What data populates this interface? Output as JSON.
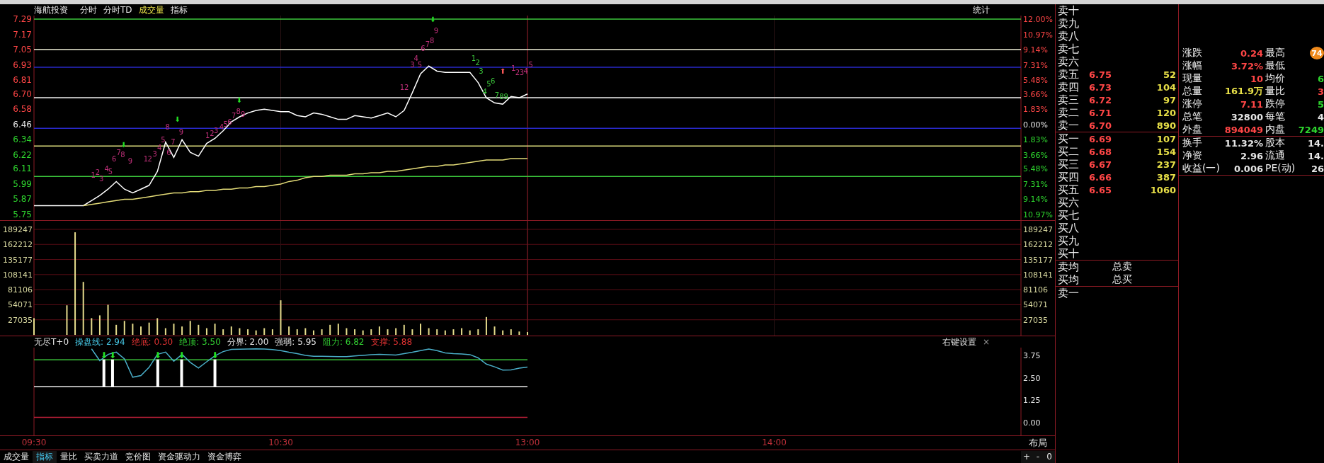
{
  "header": {
    "title": "海航投资",
    "tabs": [
      {
        "label": "分时",
        "selected": false
      },
      {
        "label": "分时TD",
        "selected": false
      },
      {
        "label": "成交量",
        "selected": true
      },
      {
        "label": "指标",
        "selected": false
      }
    ],
    "stats_label": "统计"
  },
  "price_chart": {
    "pct_axis": [
      {
        "label": "12.00%",
        "kind": "up"
      },
      {
        "label": "10.97%",
        "kind": "up"
      },
      {
        "label": "9.14%",
        "kind": "up"
      },
      {
        "label": "7.31%",
        "kind": "up"
      },
      {
        "label": "5.48%",
        "kind": "up"
      },
      {
        "label": "3.66%",
        "kind": "up"
      },
      {
        "label": "1.83%",
        "kind": "up"
      },
      {
        "label": "0.00%",
        "kind": "flat"
      },
      {
        "label": "1.83%",
        "kind": "down"
      },
      {
        "label": "3.66%",
        "kind": "down"
      },
      {
        "label": "5.48%",
        "kind": "down"
      },
      {
        "label": "7.31%",
        "kind": "down"
      },
      {
        "label": "9.14%",
        "kind": "down"
      },
      {
        "label": "10.97%",
        "kind": "down"
      }
    ],
    "chart_data": {
      "type": "line",
      "ylim": [
        5.75,
        7.29
      ],
      "yticks": [
        {
          "value": 7.29,
          "label": "7.29"
        },
        {
          "value": 7.17,
          "label": "7.17"
        },
        {
          "value": 7.05,
          "label": "7.05"
        },
        {
          "value": 6.93,
          "label": "6.93"
        },
        {
          "value": 6.81,
          "label": "6.81"
        },
        {
          "value": 6.7,
          "label": "6.70"
        },
        {
          "value": 6.58,
          "label": "6.58"
        },
        {
          "value": 6.46,
          "label": "6.46"
        },
        {
          "value": 6.34,
          "label": "6.34"
        },
        {
          "value": 6.22,
          "label": "6.22"
        },
        {
          "value": 6.11,
          "label": "6.11"
        },
        {
          "value": 5.99,
          "label": "5.99"
        },
        {
          "value": 5.87,
          "label": "5.87"
        },
        {
          "value": 5.75,
          "label": "5.75"
        }
      ],
      "categories": [
        null,
        null,
        null,
        null,
        null,
        null,
        null,
        null,
        null,
        null,
        null,
        null,
        null,
        null,
        null,
        null,
        null,
        null,
        null,
        null,
        null,
        null,
        null,
        null,
        null,
        null,
        null,
        null,
        null,
        null,
        null,
        null,
        null,
        null,
        null,
        null,
        null,
        null,
        null,
        null,
        null,
        null,
        null,
        null,
        null,
        null,
        null,
        null,
        null,
        null,
        null,
        null,
        null,
        null,
        null,
        null,
        null,
        null,
        null,
        null,
        null,
        null,
        null,
        null,
        null,
        null,
        null,
        null,
        null,
        null,
        null,
        null,
        null,
        null,
        null,
        null,
        null,
        null,
        null,
        null,
        null,
        null,
        null,
        null,
        null,
        null,
        null,
        null,
        null,
        null,
        null,
        null,
        null,
        null,
        null,
        null,
        null,
        null,
        null,
        null,
        null,
        null,
        null,
        null,
        null,
        null,
        null,
        null,
        null,
        null,
        null,
        null,
        null,
        null,
        null,
        null,
        null,
        null,
        null,
        null,
        null
      ],
      "series": [
        {
          "color": "#ffffff",
          "values": [
            5.82,
            5.82,
            5.82,
            5.82,
            5.82,
            5.82,
            5.82,
            5.86,
            5.9,
            5.95,
            6.01,
            5.95,
            5.92,
            5.95,
            5.98,
            6.09,
            6.32,
            6.2,
            6.34,
            6.24,
            6.21,
            6.31,
            6.35,
            6.41,
            6.48,
            6.52,
            6.55,
            6.57,
            6.58,
            6.57,
            6.56,
            6.56,
            6.53,
            6.52,
            6.55,
            6.54,
            6.52,
            6.5,
            6.5,
            6.53,
            6.52,
            6.51,
            6.53,
            6.55,
            6.52,
            6.57,
            6.71,
            6.86,
            6.92,
            6.88,
            6.87,
            6.87,
            6.87,
            6.87,
            6.79,
            6.67,
            6.63,
            6.62,
            6.68,
            6.67,
            6.7,
            null,
            null,
            null,
            null,
            null,
            null,
            null,
            null,
            null,
            null,
            null,
            null,
            null,
            null,
            null,
            null,
            null,
            null,
            null,
            null,
            null,
            null,
            null,
            null,
            null,
            null,
            null,
            null,
            null,
            null,
            null,
            null,
            null,
            null,
            null,
            null,
            null,
            null,
            null,
            null,
            null,
            null,
            null,
            null,
            null,
            null,
            null,
            null,
            null,
            null,
            null,
            null,
            null,
            null,
            null,
            null,
            null,
            null,
            null,
            null
          ]
        },
        {
          "color": "#e4dc78",
          "values": [
            null,
            null,
            null,
            null,
            null,
            null,
            5.82,
            5.83,
            5.84,
            5.85,
            5.86,
            5.87,
            5.87,
            5.88,
            5.89,
            5.9,
            5.91,
            5.92,
            5.92,
            5.93,
            5.93,
            5.94,
            5.94,
            5.95,
            5.95,
            5.96,
            5.96,
            5.97,
            5.97,
            5.98,
            5.99,
            6.01,
            6.02,
            6.04,
            6.05,
            6.05,
            6.06,
            6.06,
            6.06,
            6.07,
            6.07,
            6.08,
            6.08,
            6.09,
            6.09,
            6.1,
            6.11,
            6.12,
            6.13,
            6.13,
            6.14,
            6.14,
            6.15,
            6.16,
            6.17,
            6.18,
            6.18,
            6.18,
            6.19,
            6.19,
            6.19,
            null,
            null,
            null,
            null,
            null,
            null,
            null,
            null,
            null,
            null,
            null,
            null,
            null,
            null,
            null,
            null,
            null,
            null,
            null,
            null,
            null,
            null,
            null,
            null,
            null,
            null,
            null,
            null,
            null,
            null,
            null,
            null,
            null,
            null,
            null,
            null,
            null,
            null,
            null,
            null,
            null,
            null,
            null,
            null,
            null,
            null,
            null,
            null,
            null,
            null,
            null,
            null,
            null,
            null,
            null,
            null,
            null,
            null,
            null,
            null
          ]
        }
      ],
      "ref_lines": [
        {
          "axis": "y",
          "value": 7.29,
          "color": "#3cc83c"
        },
        {
          "axis": "y",
          "value": 7.05,
          "color": "#f0f0d8"
        },
        {
          "axis": "y",
          "value": 6.91,
          "color": "#2828c8"
        },
        {
          "axis": "y",
          "value": 6.67,
          "color": "#f0f0f0"
        },
        {
          "axis": "y",
          "value": 6.43,
          "color": "#2828c8"
        },
        {
          "axis": "y",
          "value": 6.29,
          "color": "#e0e080"
        },
        {
          "axis": "y",
          "value": 6.05,
          "color": "#3cc83c"
        }
      ],
      "annotations": [
        "1",
        "2",
        "3",
        "4",
        "5",
        "6",
        "7",
        "8",
        "9",
        "⬇",
        "1",
        "2",
        "3",
        "4",
        "5",
        "6",
        "7",
        "8",
        "9",
        "⬇",
        "1",
        "2",
        "3",
        "4",
        "5",
        "6",
        "7",
        "8",
        "9",
        "⬇",
        "1",
        "2",
        "3",
        "4",
        "5",
        "6",
        "7",
        "8",
        "9",
        "⬇",
        "1",
        "2",
        "3",
        "4",
        "5",
        "6",
        "7",
        "8",
        "9",
        "⬆",
        "1",
        "2",
        "3",
        "4",
        "5"
      ]
    },
    "annotation_styles": [
      {
        "color": "#c0307a"
      },
      {
        "color": "#c0307a"
      },
      {
        "color": "#c0307a"
      },
      {
        "color": "#c0307a"
      },
      {
        "color": "#c0307a"
      },
      {
        "color": "#c0307a"
      },
      {
        "color": "#c0307a"
      },
      {
        "color": "#c0307a"
      },
      {
        "color": "#c0307a"
      },
      {
        "color": "#22e022"
      },
      {
        "color": "#c0307a"
      },
      {
        "color": "#c0307a"
      },
      {
        "color": "#c0307a"
      },
      {
        "color": "#c0307a"
      },
      {
        "color": "#c0307a"
      },
      {
        "color": "#c0307a"
      },
      {
        "color": "#c0307a"
      },
      {
        "color": "#c0307a"
      },
      {
        "color": "#c0307a"
      },
      {
        "color": "#22e022"
      },
      {
        "color": "#c0307a"
      },
      {
        "color": "#c0307a"
      },
      {
        "color": "#c0307a"
      },
      {
        "color": "#c0307a"
      },
      {
        "color": "#c0307a"
      },
      {
        "color": "#c0307a"
      },
      {
        "color": "#c0307a"
      },
      {
        "color": "#c0307a"
      },
      {
        "color": "#c0307a"
      },
      {
        "color": "#22e022"
      },
      {
        "color": "#c0307a"
      },
      {
        "color": "#c0307a"
      },
      {
        "color": "#c0307a"
      },
      {
        "color": "#c0307a"
      },
      {
        "color": "#c0307a"
      },
      {
        "color": "#c0307a"
      },
      {
        "color": "#c0307a"
      },
      {
        "color": "#c0307a"
      },
      {
        "color": "#c0307a"
      },
      {
        "color": "#22e022"
      },
      {
        "color": "#3cc83c"
      },
      {
        "color": "#3cc83c"
      },
      {
        "color": "#3cc83c"
      },
      {
        "color": "#3cc83c"
      },
      {
        "color": "#3cc83c"
      },
      {
        "color": "#3cc83c"
      },
      {
        "color": "#3cc83c"
      },
      {
        "color": "#3cc83c"
      },
      {
        "color": "#3cc83c"
      },
      {
        "color": "#ff5a5a"
      },
      {
        "color": "#c0307a"
      },
      {
        "color": "#c0307a"
      },
      {
        "color": "#c0307a"
      },
      {
        "color": "#c0307a"
      },
      {
        "color": "#c0307a"
      }
    ]
  },
  "volume": {
    "right_axis": [
      "189247",
      "162212",
      "135177",
      "108141",
      "81106",
      "54071",
      "27035"
    ],
    "chart_data": {
      "type": "bar",
      "grid": true,
      "ylim": [
        0,
        204455
      ],
      "yticks": [
        {
          "value": 189247,
          "label": "189247"
        },
        {
          "value": 162212,
          "label": "162212"
        },
        {
          "value": 135177,
          "label": "135177"
        },
        {
          "value": 108141,
          "label": "108141"
        },
        {
          "value": 81106,
          "label": "81106"
        },
        {
          "value": 54071,
          "label": "54071"
        },
        {
          "value": 27035,
          "label": "27035"
        }
      ],
      "categories": [
        null,
        null,
        null,
        null,
        null,
        null,
        null,
        null,
        null,
        null,
        null,
        null,
        null,
        null,
        null,
        null,
        null,
        null,
        null,
        null,
        null,
        null,
        null,
        null,
        null,
        null,
        null,
        null,
        null,
        null,
        null,
        null,
        null,
        null,
        null,
        null,
        null,
        null,
        null,
        null,
        null,
        null,
        null,
        null,
        null,
        null,
        null,
        null,
        null,
        null,
        null,
        null,
        null,
        null,
        null,
        null,
        null,
        null,
        null,
        null,
        null,
        null,
        null,
        null,
        null,
        null,
        null,
        null,
        null,
        null,
        null,
        null,
        null,
        null,
        null,
        null,
        null,
        null,
        null,
        null,
        null,
        null,
        null,
        null,
        null,
        null,
        null,
        null,
        null,
        null,
        null,
        null,
        null,
        null,
        null,
        null,
        null,
        null,
        null,
        null,
        null,
        null,
        null,
        null,
        null,
        null,
        null,
        null,
        null,
        null,
        null,
        null,
        null,
        null,
        null,
        null,
        null,
        null,
        null,
        null,
        null
      ],
      "series": [
        {
          "color": "#e6dc8c",
          "values": [
            30000,
            0,
            0,
            0,
            53000,
            184000,
            95000,
            30000,
            35000,
            54000,
            18000,
            25000,
            20000,
            15000,
            22000,
            30000,
            12000,
            20000,
            15000,
            25000,
            18000,
            12000,
            20000,
            10000,
            15000,
            12000,
            10000,
            8000,
            12000,
            10000,
            62000,
            15000,
            10000,
            12000,
            8000,
            10000,
            18000,
            20000,
            12000,
            10000,
            8000,
            10000,
            15000,
            10000,
            12000,
            18000,
            10000,
            20000,
            12000,
            10000,
            8000,
            10000,
            12000,
            8000,
            10000,
            32000,
            15000,
            8000,
            10000,
            6000,
            5000,
            null,
            null,
            null,
            null,
            null,
            null,
            null,
            null,
            null,
            null,
            null,
            null,
            null,
            null,
            null,
            null,
            null,
            null,
            null,
            null,
            null,
            null,
            null,
            null,
            null,
            null,
            null,
            null,
            null,
            null,
            null,
            null,
            null,
            null,
            null,
            null,
            null,
            null,
            null,
            null,
            null,
            null,
            null,
            null,
            null,
            null,
            null,
            null,
            null,
            null,
            null,
            null,
            null,
            null,
            null,
            null,
            null,
            null,
            null,
            null
          ]
        }
      ]
    }
  },
  "indicator": {
    "name": "无尽T+0",
    "readings": [
      {
        "text": "操盘线: 2.94",
        "color": "#46c8e6"
      },
      {
        "text": "绝底: 0.30",
        "color": "#e03232"
      },
      {
        "text": "绝顶: 3.50",
        "color": "#32d232"
      },
      {
        "text": "分界: 2.00",
        "color": "#e6e6e6"
      },
      {
        "text": "强弱: 5.95",
        "color": "#e6e6e6"
      },
      {
        "text": "阻力: 6.82",
        "color": "#32d232"
      },
      {
        "text": "支撑: 5.88",
        "color": "#e03232"
      }
    ],
    "settings": "右键设置",
    "close": "×",
    "chart_data": {
      "type": "line",
      "ylim": [
        -0.71,
        4.18
      ],
      "yticks": [
        {
          "value": 3.75,
          "label": "3.75"
        },
        {
          "value": 2.5,
          "label": "2.50"
        },
        {
          "value": 1.25,
          "label": "1.25"
        },
        {
          "value": 0,
          "label": "0.00"
        }
      ],
      "categories": [
        "09:30",
        null,
        null,
        null,
        null,
        null,
        null,
        null,
        null,
        null,
        null,
        null,
        null,
        null,
        null,
        null,
        null,
        null,
        null,
        null,
        null,
        null,
        null,
        null,
        null,
        null,
        null,
        null,
        null,
        null,
        "10:30",
        null,
        null,
        null,
        null,
        null,
        null,
        null,
        null,
        null,
        null,
        null,
        null,
        null,
        null,
        null,
        null,
        null,
        null,
        null,
        null,
        null,
        null,
        null,
        null,
        null,
        null,
        null,
        null,
        null,
        "13:00",
        null,
        null,
        null,
        null,
        null,
        null,
        null,
        null,
        null,
        null,
        null,
        null,
        null,
        null,
        null,
        null,
        null,
        null,
        null,
        null,
        null,
        null,
        null,
        null,
        null,
        null,
        null,
        null,
        null,
        "14:00",
        null,
        null,
        null,
        null,
        null,
        null,
        null,
        null,
        null,
        null,
        null,
        null,
        null,
        null,
        null,
        null,
        null,
        null,
        null,
        null,
        null,
        null,
        null,
        null,
        null,
        null,
        null,
        null,
        null,
        null
      ],
      "series": [
        {
          "color": "#4aaec8",
          "values": [
            null,
            null,
            null,
            null,
            null,
            null,
            null,
            4.11,
            3.45,
            3.8,
            3.93,
            3.55,
            2.53,
            2.62,
            3.08,
            3.8,
            3.93,
            3.42,
            3.8,
            3.36,
            3.04,
            3.39,
            3.72,
            3.96,
            4.08,
            4.09,
            4.1,
            4.11,
            4.1,
            4.07,
            4.01,
            3.92,
            3.84,
            3.75,
            3.7,
            3.7,
            3.69,
            3.68,
            3.68,
            3.72,
            3.75,
            3.78,
            3.81,
            3.79,
            3.77,
            3.84,
            3.92,
            4.01,
            4.1,
            4.01,
            3.89,
            3.85,
            3.82,
            3.79,
            3.61,
            3.26,
            3.11,
            2.93,
            2.94,
            3.04,
            3.1,
            null,
            null,
            null,
            null,
            null,
            null,
            null,
            null,
            null,
            null,
            null,
            null,
            null,
            null,
            null,
            null,
            null,
            null,
            null,
            null,
            null,
            null,
            null,
            null,
            null,
            null,
            null,
            null,
            null,
            null,
            null,
            null,
            null,
            null,
            null,
            null,
            null,
            null,
            null,
            null,
            null,
            null,
            null,
            null,
            null,
            null,
            null,
            null,
            null,
            null,
            null,
            null,
            null,
            null,
            null,
            null,
            null,
            null,
            null,
            null
          ]
        }
      ],
      "ref_lines": [
        {
          "axis": "y",
          "value": 3.5,
          "color": "#3cc83c"
        },
        {
          "axis": "y",
          "value": 2.0,
          "color": "#f0f0f0"
        },
        {
          "axis": "y",
          "value": 0.3,
          "color": "#c0203a"
        }
      ],
      "annotations": [
        "⬇",
        "⬇",
        "⬇",
        "⬇",
        "⬇"
      ]
    },
    "annotation_styles": [
      {
        "color": "#22e022"
      },
      {
        "color": "#22e022"
      },
      {
        "color": "#22e022"
      },
      {
        "color": "#22e022"
      },
      {
        "color": "#22e022"
      }
    ]
  },
  "layout_button": "布局",
  "bottom_tabs": [
    {
      "label": "成交量",
      "selected": false
    },
    {
      "label": "指标",
      "selected": true
    },
    {
      "label": "量比",
      "selected": false
    },
    {
      "label": "买卖力道",
      "selected": false
    },
    {
      "label": "竞价图",
      "selected": false
    },
    {
      "label": "资金驱动力",
      "selected": false
    },
    {
      "label": "资金博弈",
      "selected": false
    }
  ],
  "zoom_buttons": [
    "+",
    "-",
    "0"
  ],
  "order_book": {
    "asks": [
      {
        "label": "卖十"
      },
      {
        "label": "卖九"
      },
      {
        "label": "卖八"
      },
      {
        "label": "卖七"
      },
      {
        "label": "卖六"
      },
      {
        "label": "卖五",
        "price": "6.75",
        "volume": "52",
        "kind": "up"
      },
      {
        "label": "卖四",
        "price": "6.73",
        "volume": "104",
        "kind": "up"
      },
      {
        "label": "卖三",
        "price": "6.72",
        "volume": "97",
        "kind": "up"
      },
      {
        "label": "卖二",
        "price": "6.71",
        "volume": "120",
        "kind": "up"
      },
      {
        "label": "卖一",
        "price": "6.70",
        "volume": "890",
        "kind": "up"
      }
    ],
    "bids": [
      {
        "label": "买一",
        "price": "6.69",
        "volume": "107",
        "kind": "up"
      },
      {
        "label": "买二",
        "price": "6.68",
        "volume": "154",
        "kind": "up"
      },
      {
        "label": "买三",
        "price": "6.67",
        "volume": "237",
        "kind": "up"
      },
      {
        "label": "买四",
        "price": "6.66",
        "volume": "387",
        "kind": "up"
      },
      {
        "label": "买五",
        "price": "6.65",
        "volume": "1060",
        "kind": "up"
      },
      {
        "label": "买六"
      },
      {
        "label": "买七"
      },
      {
        "label": "买八"
      },
      {
        "label": "买九"
      },
      {
        "label": "买十"
      }
    ],
    "summary": [
      {
        "label": "卖均",
        "total_label": "总卖"
      },
      {
        "label": "买均",
        "total_label": "总买"
      }
    ],
    "tail_row": "卖一"
  },
  "quote": {
    "rows_top": [
      {
        "left": {
          "label": "涨跌",
          "value": "0.24",
          "kind": "up"
        },
        "right": {
          "label": "最高",
          "badge": "74"
        }
      },
      {
        "left": {
          "label": "涨幅",
          "value": "3.72%",
          "kind": "up"
        },
        "right": {
          "label": "最低"
        }
      },
      {
        "left": {
          "label": "现量",
          "value": "10",
          "kind": "up"
        },
        "right": {
          "label": "均价",
          "value": "6",
          "kind": "down"
        }
      },
      {
        "left": {
          "label": "总量",
          "value": "161.9万",
          "kind": "volume"
        },
        "right": {
          "label": "量比",
          "value": "3",
          "kind": "up"
        }
      },
      {
        "left": {
          "label": "涨停",
          "value": "7.11",
          "kind": "up"
        },
        "right": {
          "label": "跌停",
          "value": "5",
          "kind": "down"
        }
      },
      {
        "left": {
          "label": "总笔",
          "value": "32800",
          "kind": "flat"
        },
        "right": {
          "label": "每笔",
          "value": "4",
          "kind": "flat"
        }
      },
      {
        "left": {
          "label": "外盘",
          "value": "894049",
          "kind": "up"
        },
        "right": {
          "label": "内盘",
          "value": "7249",
          "kind": "down"
        }
      }
    ],
    "rows_bottom": [
      {
        "left": {
          "label": "换手",
          "value": "11.32%",
          "kind": "flat"
        },
        "right": {
          "label": "股本",
          "value": "14.",
          "kind": "flat"
        }
      },
      {
        "left": {
          "label": "净资",
          "value": "2.96",
          "kind": "flat"
        },
        "right": {
          "label": "流通",
          "value": "14.",
          "kind": "flat"
        }
      },
      {
        "left": {
          "label": "收益(一)",
          "value": "0.006",
          "kind": "flat"
        },
        "right": {
          "label": "PE(动)",
          "value": "26",
          "kind": "flat"
        }
      }
    ]
  }
}
